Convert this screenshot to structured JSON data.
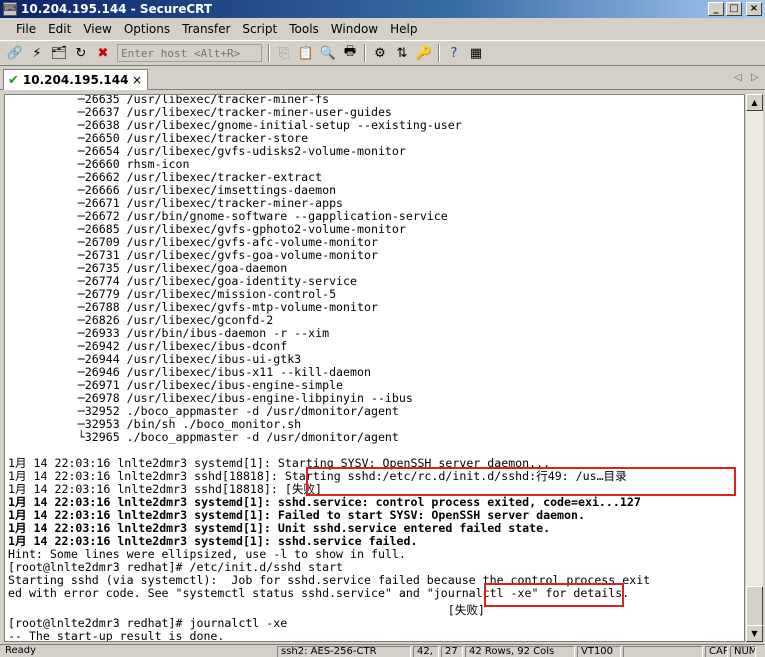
{
  "window": {
    "title": "10.204.195.144 - SecureCRT",
    "minimize_label": "_",
    "maximize_label": "□",
    "close_label": "×"
  },
  "menu": [
    "File",
    "Edit",
    "View",
    "Options",
    "Transfer",
    "Script",
    "Tools",
    "Window",
    "Help"
  ],
  "toolbar": {
    "host_placeholder": "Enter host <Alt+R>"
  },
  "tab": {
    "label": "10.204.195.144",
    "close": "×",
    "prev": "◁",
    "next": "▷"
  },
  "terminal": {
    "lines": [
      "          ─26635 /usr/libexec/tracker-miner-fs",
      "          ─26637 /usr/libexec/tracker-miner-user-guides",
      "          ─26638 /usr/libexec/gnome-initial-setup --existing-user",
      "          ─26650 /usr/libexec/tracker-store",
      "          ─26654 /usr/libexec/gvfs-udisks2-volume-monitor",
      "          ─26660 rhsm-icon",
      "          ─26662 /usr/libexec/tracker-extract",
      "          ─26666 /usr/libexec/imsettings-daemon",
      "          ─26671 /usr/libexec/tracker-miner-apps",
      "          ─26672 /usr/bin/gnome-software --gapplication-service",
      "          ─26685 /usr/libexec/gvfs-gphoto2-volume-monitor",
      "          ─26709 /usr/libexec/gvfs-afc-volume-monitor",
      "          ─26731 /usr/libexec/gvfs-goa-volume-monitor",
      "          ─26735 /usr/libexec/goa-daemon",
      "          ─26774 /usr/libexec/goa-identity-service",
      "          ─26779 /usr/libexec/mission-control-5",
      "          ─26788 /usr/libexec/gvfs-mtp-volume-monitor",
      "          ─26826 /usr/libexec/gconfd-2",
      "          ─26933 /usr/bin/ibus-daemon -r --xim",
      "          ─26942 /usr/libexec/ibus-dconf",
      "          ─26944 /usr/libexec/ibus-ui-gtk3",
      "          ─26946 /usr/libexec/ibus-x11 --kill-daemon",
      "          ─26971 /usr/libexec/ibus-engine-simple",
      "          ─26978 /usr/libexec/ibus-engine-libpinyin --ibus",
      "          ─32952 ./boco_appmaster -d /usr/dmonitor/agent",
      "          ─32953 /bin/sh ./boco_monitor.sh",
      "          └32965 ./boco_appmaster -d /usr/dmonitor/agent",
      "",
      "1月 14 22:03:16 lnlte2dmr3 systemd[1]: Starting SYSV: OpenSSH server daemon...",
      "1月 14 22:03:16 lnlte2dmr3 sshd[18818]: Starting sshd:/etc/rc.d/init.d/sshd:行49: /us…目录",
      "1月 14 22:03:16 lnlte2dmr3 sshd[18818]: [失败]",
      "1月 14 22:03:16 lnlte2dmr3 systemd[1]: sshd.service: control process exited, code=exi...127",
      "1月 14 22:03:16 lnlte2dmr3 systemd[1]: Failed to start SYSV: OpenSSH server daemon.",
      "1月 14 22:03:16 lnlte2dmr3 systemd[1]: Unit sshd.service entered failed state.",
      "1月 14 22:03:16 lnlte2dmr3 systemd[1]: sshd.service failed.",
      "Hint: Some lines were ellipsized, use -l to show in full.",
      "[root@lnlte2dmr3 redhat]# /etc/init.d/sshd start",
      "Starting sshd (via systemctl):  Job for sshd.service failed because the control process exit",
      "ed with error code. See \"systemctl status sshd.service\" and \"journalctl -xe\" for details.",
      "                                                               [失败]",
      "[root@lnlte2dmr3 redhat]# journalctl -xe",
      "-- The start-up result is done."
    ]
  },
  "statusbar": {
    "ready": "Ready",
    "protocol": "ssh2: AES-256-CTR",
    "row": "42,",
    "col": "27",
    "size": "42 Rows, 92 Cols",
    "term": "VT100",
    "cap": "CAP",
    "num": "NUM"
  }
}
